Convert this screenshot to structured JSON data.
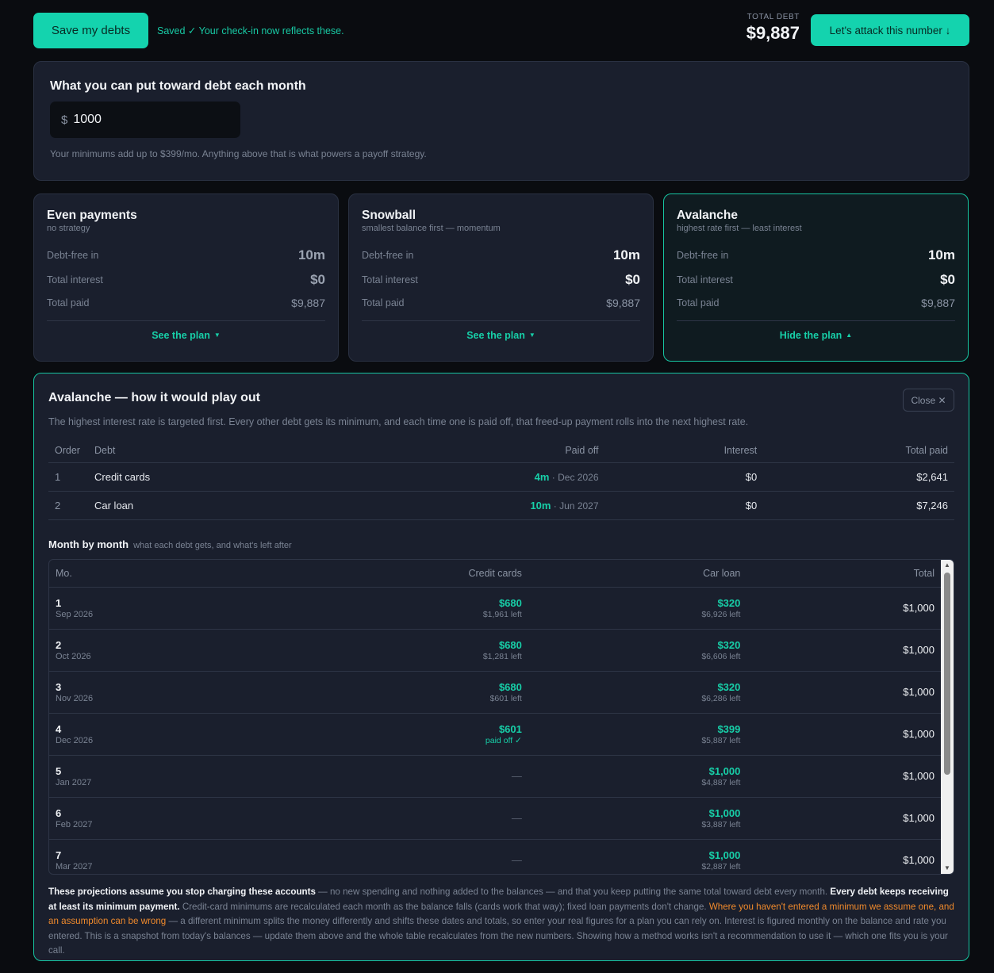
{
  "topbar": {
    "save_label": "Save my debts",
    "saved_msg": "Saved ✓ Your check-in now reflects these.",
    "total_label": "TOTAL DEBT",
    "total_value": "$9,887",
    "attack_label": "Let's attack this number ↓"
  },
  "monthly": {
    "title": "What you can put toward debt each month",
    "currency": "$",
    "amount": "1000",
    "note": "Your minimums add up to $399/mo. Anything above that is what powers a payoff strategy."
  },
  "strategies": [
    {
      "name": "Even payments",
      "sub": "no strategy",
      "k1": "Debt-free in",
      "v1": "10m",
      "k2": "Total interest",
      "v2": "$0",
      "k3": "Total paid",
      "v3": "$9,887",
      "toggle": "See the plan"
    },
    {
      "name": "Snowball",
      "sub": "smallest balance first — momentum",
      "k1": "Debt-free in",
      "v1": "10m",
      "k2": "Total interest",
      "v2": "$0",
      "k3": "Total paid",
      "v3": "$9,887",
      "toggle": "See the plan"
    },
    {
      "name": "Avalanche",
      "sub": "highest rate first — least interest",
      "k1": "Debt-free in",
      "v1": "10m",
      "k2": "Total interest",
      "v2": "$0",
      "k3": "Total paid",
      "v3": "$9,887",
      "toggle": "Hide the plan"
    }
  ],
  "detail": {
    "title": "Avalanche — how it would play out",
    "close_label": "Close ✕",
    "description": "The highest interest rate is targeted first. Every other debt gets its minimum, and each time one is paid off, that freed-up payment rolls into the next highest rate.",
    "order_headers": [
      "Order",
      "Debt",
      "Paid off",
      "Interest",
      "Total paid"
    ],
    "order_rows": [
      {
        "order": "1",
        "debt": "Credit cards",
        "months": "4m",
        "date": " · Dec 2026",
        "interest": "$0",
        "total": "$2,641"
      },
      {
        "order": "2",
        "debt": "Car loan",
        "months": "10m",
        "date": " · Jun 2027",
        "interest": "$0",
        "total": "$7,246"
      }
    ],
    "mbm_title": "Month by month",
    "mbm_sub": "what each debt gets, and what's left after",
    "mbm_headers": [
      "Mo.",
      "Credit cards",
      "Car loan",
      "Total"
    ],
    "mbm_rows": [
      {
        "n": "1",
        "date": "Sep 2026",
        "cc_pay": "$680",
        "cc_left": "$1,961 left",
        "car_pay": "$320",
        "car_left": "$6,926 left",
        "total": "$1,000"
      },
      {
        "n": "2",
        "date": "Oct 2026",
        "cc_pay": "$680",
        "cc_left": "$1,281 left",
        "car_pay": "$320",
        "car_left": "$6,606 left",
        "total": "$1,000"
      },
      {
        "n": "3",
        "date": "Nov 2026",
        "cc_pay": "$680",
        "cc_left": "$601 left",
        "car_pay": "$320",
        "car_left": "$6,286 left",
        "total": "$1,000"
      },
      {
        "n": "4",
        "date": "Dec 2026",
        "cc_pay": "$601",
        "cc_left": "paid off ✓",
        "car_pay": "$399",
        "car_left": "$5,887 left",
        "total": "$1,000"
      },
      {
        "n": "5",
        "date": "Jan 2027",
        "cc_dash": "—",
        "car_pay": "$1,000",
        "car_left": "$4,887 left",
        "total": "$1,000"
      },
      {
        "n": "6",
        "date": "Feb 2027",
        "cc_dash": "—",
        "car_pay": "$1,000",
        "car_left": "$3,887 left",
        "total": "$1,000"
      },
      {
        "n": "7",
        "date": "Mar 2027",
        "cc_dash": "—",
        "car_pay": "$1,000",
        "car_left": "$2,887 left",
        "total": "$1,000"
      }
    ],
    "footnote": {
      "b1": "These projections assume you stop charging these accounts",
      "t1": " — no new spending and nothing added to the balances — and that you keep putting the same total toward debt every month. ",
      "b2": "Every debt keeps receiving at least its minimum payment.",
      "t2": " Credit-card minimums are recalculated each month as the balance falls (cards work that way); fixed loan payments don't change. ",
      "w1": "Where you haven't entered a minimum we assume one, and an assumption can be wrong",
      "t3": " — a different minimum splits the money differently and shifts these dates and totals, so enter your real figures for a plan you can rely on. Interest is figured monthly on the balance and rate you entered. This is a snapshot from today's balances — update them above and the whole table recalculates from the new numbers. Showing how a method works isn't a recommendation to use it — which one fits you is your call."
    }
  },
  "colors": {
    "accent": "#14d3ae",
    "bg": "#0a0c10",
    "card": "#1a1f2d",
    "warn": "#f08a2c"
  }
}
